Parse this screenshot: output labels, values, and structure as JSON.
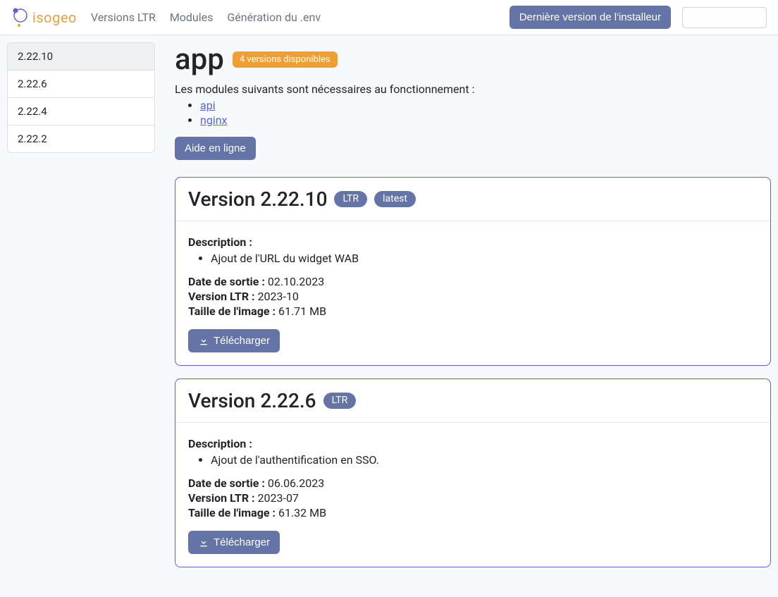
{
  "nav": {
    "logo_text": "isogeo",
    "links": [
      {
        "label": "Versions LTR"
      },
      {
        "label": "Modules"
      },
      {
        "label": "Génération du .env"
      }
    ],
    "installer_btn": "Dernière version de l'installeur",
    "search_placeholder": ""
  },
  "sidebar": {
    "items": [
      {
        "label": "2.22.10",
        "active": true
      },
      {
        "label": "2.22.6",
        "active": false
      },
      {
        "label": "2.22.4",
        "active": false
      },
      {
        "label": "2.22.2",
        "active": false
      }
    ]
  },
  "page": {
    "title": "app",
    "versions_badge": "4 versions disponibles",
    "intro": "Les modules suivants sont nécessaires au fonctionnement :",
    "deps": [
      "api",
      "nginx"
    ],
    "help_btn": "Aide en ligne"
  },
  "labels": {
    "description": "Description :",
    "release_date": "Date de sortie :",
    "ltr_version": "Version LTR :",
    "image_size": "Taille de l'image :",
    "download": "Télécharger",
    "version_prefix": "Version"
  },
  "versions": [
    {
      "number": "2.22.10",
      "tags": [
        "LTR",
        "latest"
      ],
      "description_items": [
        "Ajout de l'URL du widget WAB"
      ],
      "release_date": "02.10.2023",
      "ltr": "2023-10",
      "size": "61.71 MB"
    },
    {
      "number": "2.22.6",
      "tags": [
        "LTR"
      ],
      "description_items": [
        "Ajout de l'authentification en SSO."
      ],
      "release_date": "06.06.2023",
      "ltr": "2023-07",
      "size": "61.32 MB"
    }
  ]
}
